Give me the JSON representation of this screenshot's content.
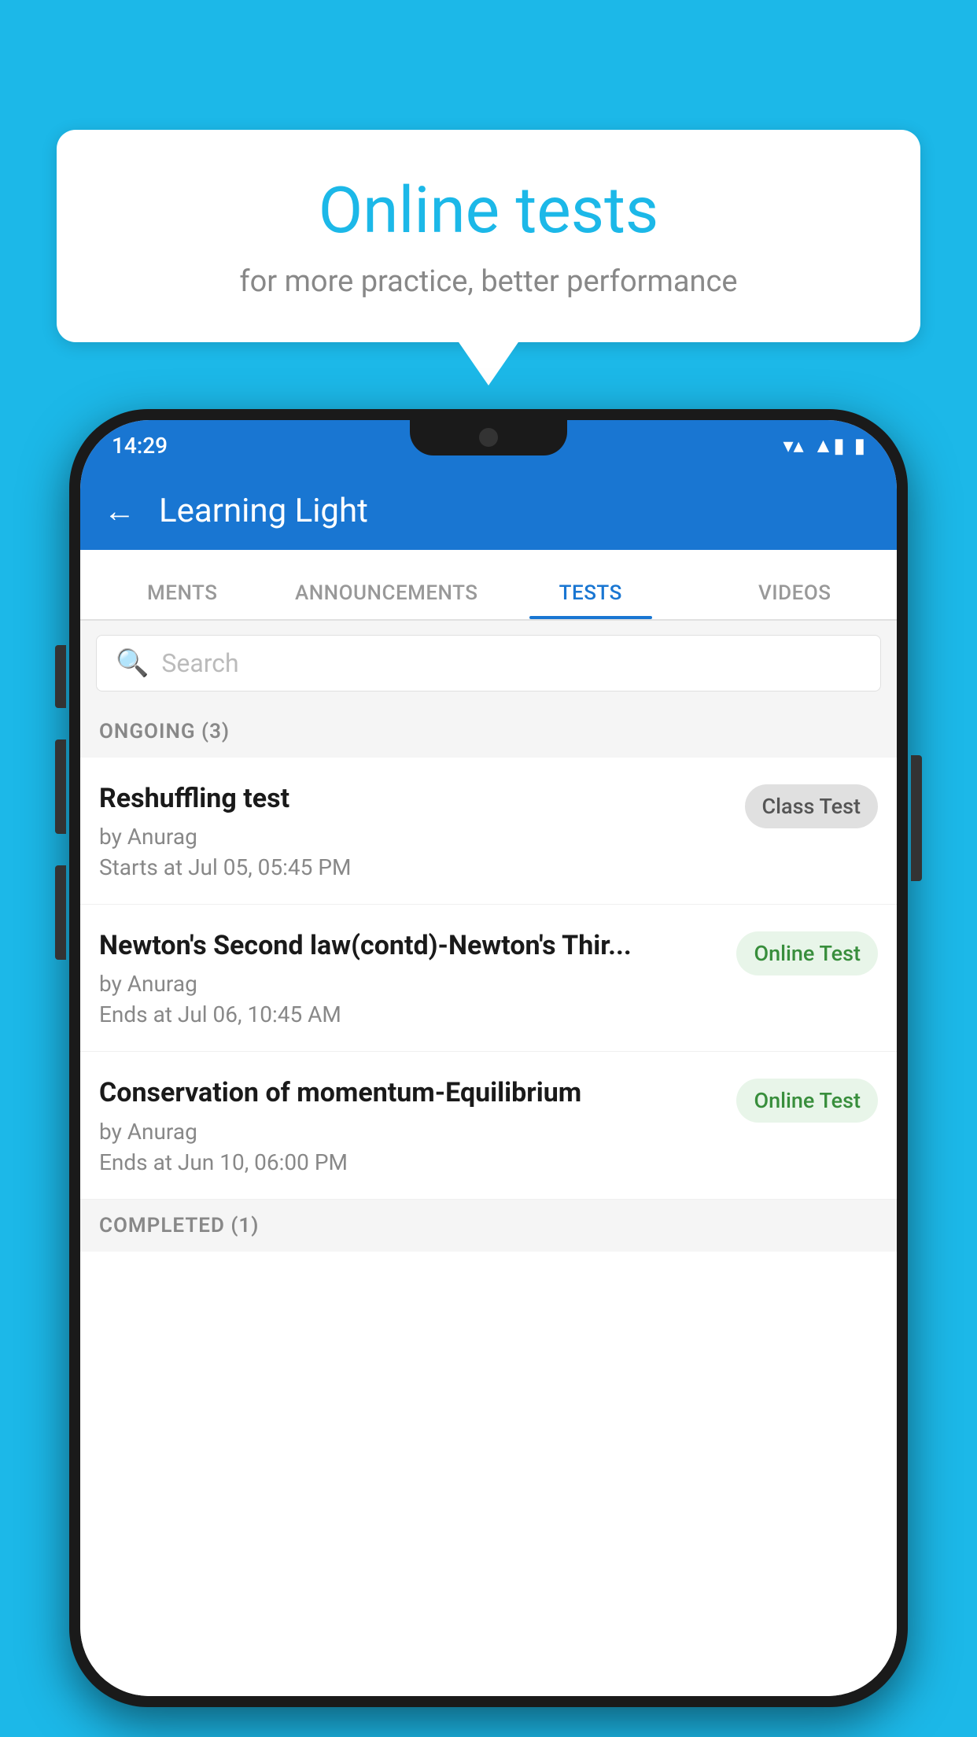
{
  "background_color": "#1cb8e8",
  "speech_bubble": {
    "title": "Online tests",
    "subtitle": "for more practice, better performance"
  },
  "phone": {
    "status_bar": {
      "time": "14:29",
      "wifi_icon": "▼",
      "signal_icon": "▲",
      "battery_icon": "▮"
    },
    "header": {
      "back_label": "←",
      "title": "Learning Light"
    },
    "tabs": [
      {
        "label": "MENTS",
        "active": false
      },
      {
        "label": "ANNOUNCEMENTS",
        "active": false
      },
      {
        "label": "TESTS",
        "active": true
      },
      {
        "label": "VIDEOS",
        "active": false
      }
    ],
    "search": {
      "placeholder": "Search"
    },
    "ongoing_section": {
      "label": "ONGOING (3)"
    },
    "tests": [
      {
        "title": "Reshuffling test",
        "author": "by Anurag",
        "time_label": "Starts at",
        "time": "Jul 05, 05:45 PM",
        "badge": "Class Test",
        "badge_type": "class"
      },
      {
        "title": "Newton's Second law(contd)-Newton's Thir...",
        "author": "by Anurag",
        "time_label": "Ends at",
        "time": "Jul 06, 10:45 AM",
        "badge": "Online Test",
        "badge_type": "online"
      },
      {
        "title": "Conservation of momentum-Equilibrium",
        "author": "by Anurag",
        "time_label": "Ends at",
        "time": "Jun 10, 06:00 PM",
        "badge": "Online Test",
        "badge_type": "online"
      }
    ],
    "completed_section": {
      "label": "COMPLETED (1)"
    }
  }
}
